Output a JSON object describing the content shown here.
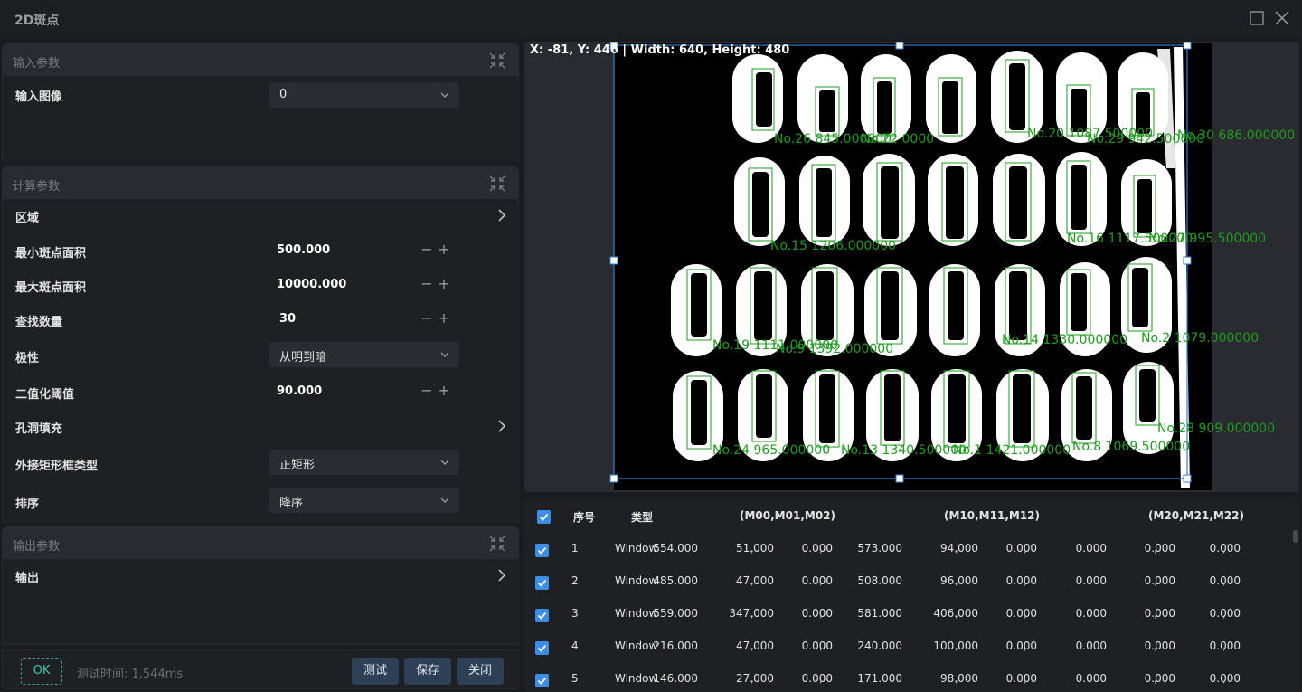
{
  "window": {
    "title": "2D斑点"
  },
  "sections": {
    "input": {
      "title": "输入参数",
      "image_label": "输入图像",
      "image_value": "0"
    },
    "calc": {
      "title": "计算参数",
      "region_label": "区域",
      "min_area_label": "最小斑点面积",
      "min_area_value": "500.000",
      "max_area_label": "最大斑点面积",
      "max_area_value": "10000.000",
      "find_count_label": "查找数量",
      "find_count_value": "30",
      "polarity_label": "极性",
      "polarity_value": "从明到暗",
      "threshold_label": "二值化阈值",
      "threshold_value": "90.000",
      "hole_fill_label": "孔洞填充",
      "bbox_type_label": "外接矩形框类型",
      "bbox_type_value": "正矩形",
      "sort_label": "排序",
      "sort_value": "降序"
    },
    "output": {
      "title": "输出参数",
      "output_label": "输出"
    }
  },
  "footer": {
    "ok": "OK",
    "test_time": "测试时间: 1,544ms",
    "test_btn": "测试",
    "save_btn": "保存",
    "close_btn": "关闭"
  },
  "viewer": {
    "coord_text": "X: -81, Y: 446 | Width: 640, Height: 480",
    "overlay_labels": [
      "No.26 845.000000",
      "No.22 0000",
      "No.20 1087.500000",
      "No.29 942.500000",
      "No.30 686.000000",
      "No.15 1206.000000",
      "No.16 1117.500000",
      "No.27 995.500000",
      "No.19 1111.000000",
      "No.9 1392.000000",
      "No.14 1330.000000",
      "No.2 1079.000000",
      "No.28 909.000000",
      "No.24 965.000000",
      "No.13 1340.500000",
      "No.1 1421.000000",
      "No.8 1069.500000"
    ]
  },
  "colors": {
    "accent": "#3b8ee8",
    "ok_green": "#3ec9a5",
    "overlay_green": "#1e9b1e",
    "roi_blue": "#2f7fd4"
  },
  "table": {
    "headers": {
      "index": "序号",
      "type": "类型",
      "m0": "(M00,M01,M02)",
      "m1": "(M10,M11,M12)",
      "m2": "(M20,M21,M22)"
    },
    "rows": [
      {
        "idx": "1",
        "type": "Window",
        "m00": "554.000",
        "m01": "51.000",
        "m02": "0.000",
        "m10": "573.000",
        "m11": "94.000",
        "m12": "0.000",
        "m20": "0.000",
        "m21": "0.000",
        "m22": "0.000"
      },
      {
        "idx": "2",
        "type": "Window",
        "m00": "485.000",
        "m01": "47.000",
        "m02": "0.000",
        "m10": "508.000",
        "m11": "96.000",
        "m12": "0.000",
        "m20": "0.000",
        "m21": "0.000",
        "m22": "0.000"
      },
      {
        "idx": "3",
        "type": "Window",
        "m00": "559.000",
        "m01": "347.000",
        "m02": "0.000",
        "m10": "581.000",
        "m11": "406.000",
        "m12": "0.000",
        "m20": "0.000",
        "m21": "0.000",
        "m22": "0.000"
      },
      {
        "idx": "4",
        "type": "Window",
        "m00": "216.000",
        "m01": "47.000",
        "m02": "0.000",
        "m10": "240.000",
        "m11": "100.000",
        "m12": "0.000",
        "m20": "0.000",
        "m21": "0.000",
        "m22": "0.000"
      },
      {
        "idx": "5",
        "type": "Window",
        "m00": "146.000",
        "m01": "27.000",
        "m02": "0.000",
        "m10": "171.000",
        "m11": "98.000",
        "m12": "0.000",
        "m20": "0.000",
        "m21": "0.000",
        "m22": "0.000"
      }
    ]
  }
}
